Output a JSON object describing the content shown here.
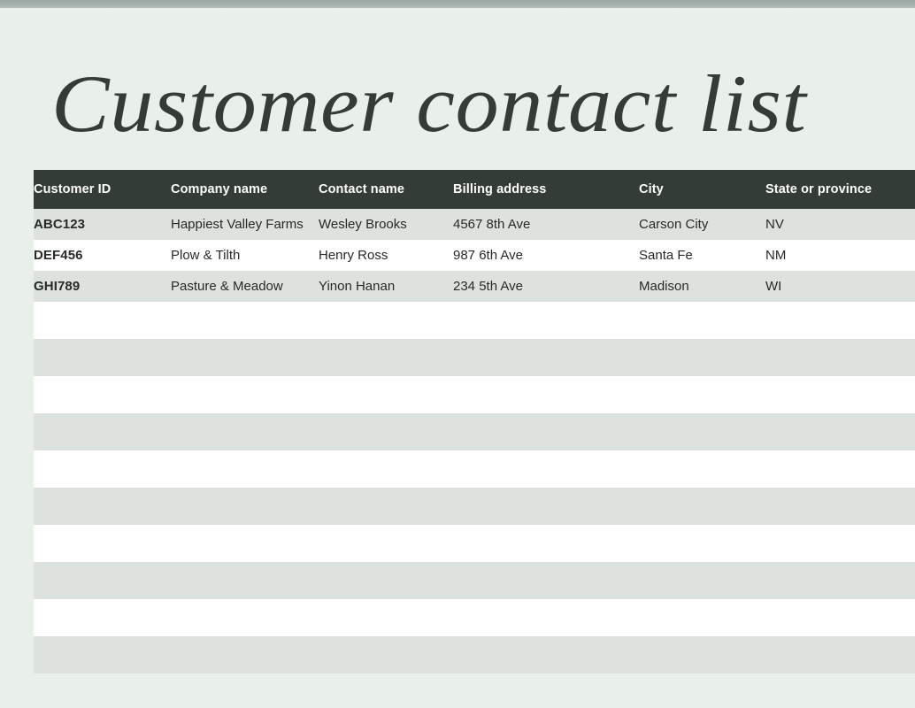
{
  "page": {
    "title": "Customer contact list",
    "background_color": "#e9efe9",
    "accent_color": "#343c36",
    "stripe_color": "#dde2df",
    "top_band_color": "#a4b0ab"
  },
  "table": {
    "columns": [
      {
        "key": "customer_id",
        "label": "Customer ID"
      },
      {
        "key": "company_name",
        "label": "Company name"
      },
      {
        "key": "contact_name",
        "label": "Contact name"
      },
      {
        "key": "billing_address",
        "label": "Billing address"
      },
      {
        "key": "city",
        "label": "City"
      },
      {
        "key": "state_or_province",
        "label": "State or province"
      }
    ],
    "rows": [
      {
        "customer_id": "ABC123",
        "company_name": "Happiest Valley Farms",
        "contact_name": "Wesley Brooks",
        "billing_address": "4567 8th Ave",
        "city": "Carson City",
        "state_or_province": "NV"
      },
      {
        "customer_id": "DEF456",
        "company_name": "Plow & Tilth",
        "contact_name": "Henry Ross",
        "billing_address": "987 6th Ave",
        "city": "Santa Fe",
        "state_or_province": "NM"
      },
      {
        "customer_id": "GHI789",
        "company_name": "Pasture & Meadow",
        "contact_name": "Yinon Hanan",
        "billing_address": "234 5th Ave",
        "city": "Madison",
        "state_or_province": "WI"
      }
    ],
    "empty_row_count": 10
  }
}
